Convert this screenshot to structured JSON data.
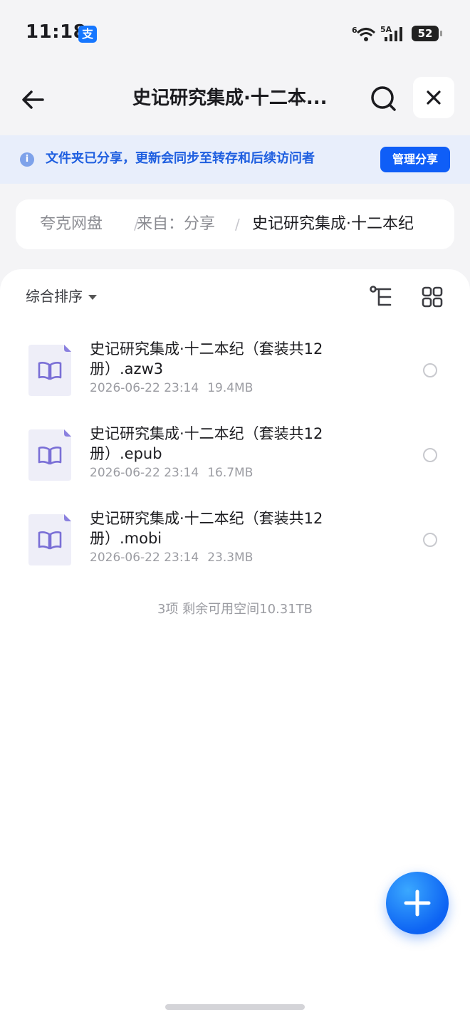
{
  "status_bar": {
    "time": "11:18",
    "app_badge": "支",
    "wifi_label": "6",
    "network_label": "5A",
    "battery": "52"
  },
  "header": {
    "title": "史记研究集成·十二本..."
  },
  "notice": {
    "text": "文件夹已分享，更新会同步至转存和后续访问者",
    "manage_label": "管理分享",
    "info_glyph": "i"
  },
  "breadcrumb": {
    "root": "夸克网盘",
    "from": "来自：分享",
    "current": "史记研究集成·十二本纪"
  },
  "toolbar": {
    "sort_label": "综合排序"
  },
  "files": [
    {
      "name": "史记研究集成·十二本纪（套装共12册）.azw3",
      "date": "2026-06-22 23:14",
      "size": "19.4MB"
    },
    {
      "name": "史记研究集成·十二本纪（套装共12册）.epub",
      "date": "2026-06-22 23:14",
      "size": "16.7MB"
    },
    {
      "name": "史记研究集成·十二本纪（套装共12册）.mobi",
      "date": "2026-06-22 23:14",
      "size": "23.3MB"
    }
  ],
  "summary": "3项 剩余可用空间10.31TB",
  "colors": {
    "accent": "#0f5ef7",
    "notice_bg": "#e8eefb",
    "file_icon": "#7a6fd6"
  },
  "icons": {
    "back": "arrow-left-icon",
    "search": "search-icon",
    "close": "close-icon",
    "info": "info-icon",
    "tree": "tree-view-icon",
    "grid": "grid-view-icon",
    "file": "book-file-icon",
    "fab": "plus-icon"
  }
}
